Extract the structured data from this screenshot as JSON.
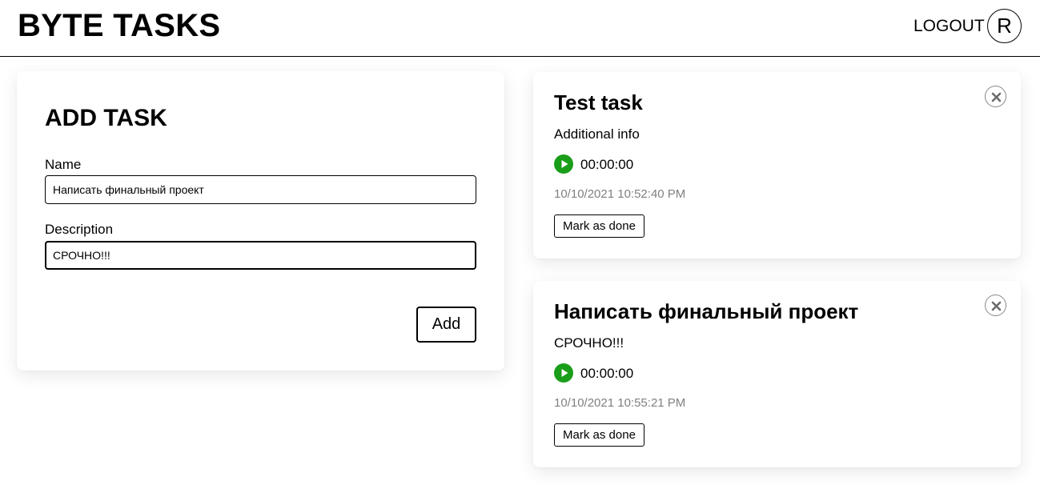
{
  "app": {
    "title": "BYTE TASKS",
    "logout_label": "LOGOUT",
    "avatar_initial": "R"
  },
  "add_form": {
    "title": "ADD TASK",
    "name_label": "Name",
    "name_value": "Написать финальный проект",
    "description_label": "Description",
    "description_value": "СРОЧНО!!!",
    "add_label": "Add"
  },
  "tasks": [
    {
      "title": "Test task",
      "description": "Additional info",
      "timer": "00:00:00",
      "created": "10/10/2021 10:52:40 PM",
      "done_label": "Mark as done",
      "play_icon": "play-icon",
      "close_icon": "close-icon"
    },
    {
      "title": "Написать финальный проект",
      "description": "СРОЧНО!!!",
      "timer": "00:00:00",
      "created": "10/10/2021 10:55:21 PM",
      "done_label": "Mark as done",
      "play_icon": "play-icon",
      "close_icon": "close-icon"
    }
  ],
  "colors": {
    "play": "#1a9e1a",
    "date_text": "#808080",
    "border": "#000000"
  }
}
